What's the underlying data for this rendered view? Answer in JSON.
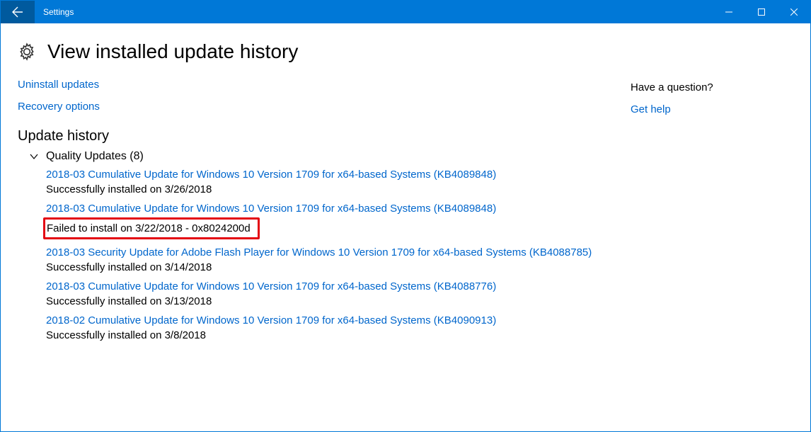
{
  "titlebar": {
    "title": "Settings"
  },
  "page": {
    "title": "View installed update history"
  },
  "links": {
    "uninstall": "Uninstall updates",
    "recovery": "Recovery options"
  },
  "history": {
    "section_title": "Update history",
    "subsection_label": "Quality Updates (8)",
    "items": [
      {
        "title": "2018-03 Cumulative Update for Windows 10 Version 1709 for x64-based Systems (KB4089848)",
        "status": "Successfully installed on 3/26/2018",
        "highlighted": false
      },
      {
        "title": "2018-03 Cumulative Update for Windows 10 Version 1709 for x64-based Systems (KB4089848)",
        "status": "Failed to install on 3/22/2018 - 0x8024200d",
        "highlighted": true
      },
      {
        "title": "2018-03 Security Update for Adobe Flash Player for Windows 10 Version 1709 for x64-based Systems (KB4088785)",
        "status": "Successfully installed on 3/14/2018",
        "highlighted": false
      },
      {
        "title": "2018-03 Cumulative Update for Windows 10 Version 1709 for x64-based Systems (KB4088776)",
        "status": "Successfully installed on 3/13/2018",
        "highlighted": false
      },
      {
        "title": "2018-02 Cumulative Update for Windows 10 Version 1709 for x64-based Systems (KB4090913)",
        "status": "Successfully installed on 3/8/2018",
        "highlighted": false
      }
    ]
  },
  "help": {
    "question": "Have a question?",
    "get_help": "Get help"
  }
}
